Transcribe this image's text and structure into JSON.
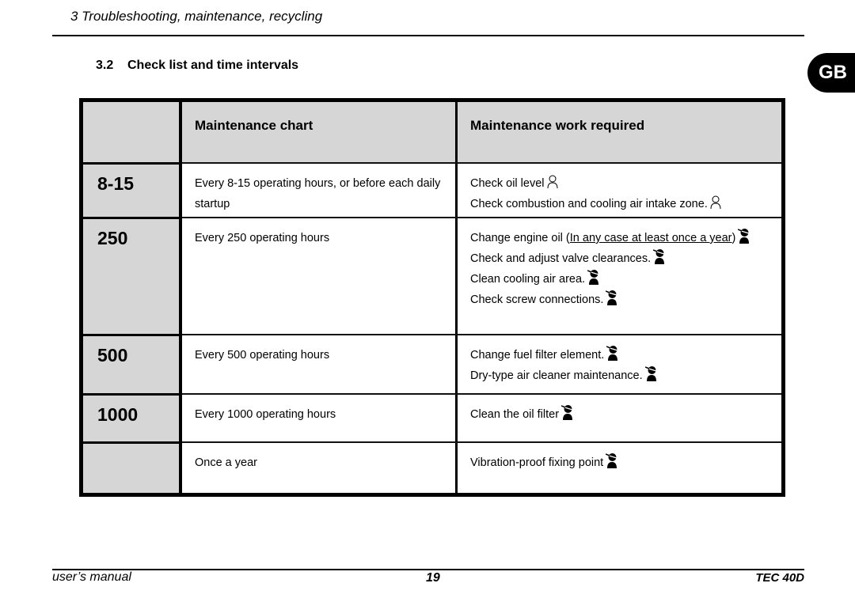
{
  "page": {
    "running_head": "3 Troubleshooting, maintenance, recycling",
    "section_number": "3.2",
    "section_title": "Check list and time intervals",
    "language_tab": "GB"
  },
  "table": {
    "headers": {
      "interval": "",
      "chart": "Maintenance chart",
      "work": "Maintenance work required"
    },
    "rows": [
      {
        "interval": "8-15",
        "description": "Every 8-15 operating hours, or before each daily startup",
        "tasks": [
          {
            "text": "Check oil level",
            "note": "",
            "icon": "user-outline-icon"
          },
          {
            "text": "Check combustion and cooling air intake zone.",
            "note": "",
            "icon": "user-outline-icon"
          }
        ]
      },
      {
        "interval": "250",
        "description": "Every 250 operating hours",
        "tasks": [
          {
            "text": "Change engine oil (",
            "note": "In any case at least once a year",
            "suffix": ")",
            "icon": "technician-icon"
          },
          {
            "text": "Check and adjust valve clearances.",
            "note": "",
            "icon": "technician-icon"
          },
          {
            "text": "Clean cooling air area.",
            "note": "",
            "icon": "technician-icon"
          },
          {
            "text": "Check screw connections.",
            "note": "",
            "icon": "technician-icon"
          }
        ]
      },
      {
        "interval": "500",
        "description": "Every 500 operating hours",
        "tasks": [
          {
            "text": "Change fuel filter element.",
            "note": "",
            "icon": "technician-icon"
          },
          {
            "text": "Dry-type air cleaner maintenance.",
            "note": "",
            "icon": "technician-icon"
          }
        ]
      },
      {
        "interval": "1000",
        "description": "Every 1000 operating hours",
        "tasks": [
          {
            "text": "Clean the oil filter",
            "note": "",
            "icon": "technician-icon"
          }
        ]
      },
      {
        "interval": "",
        "description": "Once a year",
        "tasks": [
          {
            "text": "Vibration-proof fixing point",
            "note": "",
            "icon": "technician-icon"
          }
        ]
      }
    ]
  },
  "footer": {
    "left": "user’s manual",
    "page_number": "19",
    "right": "TEC 40D"
  }
}
